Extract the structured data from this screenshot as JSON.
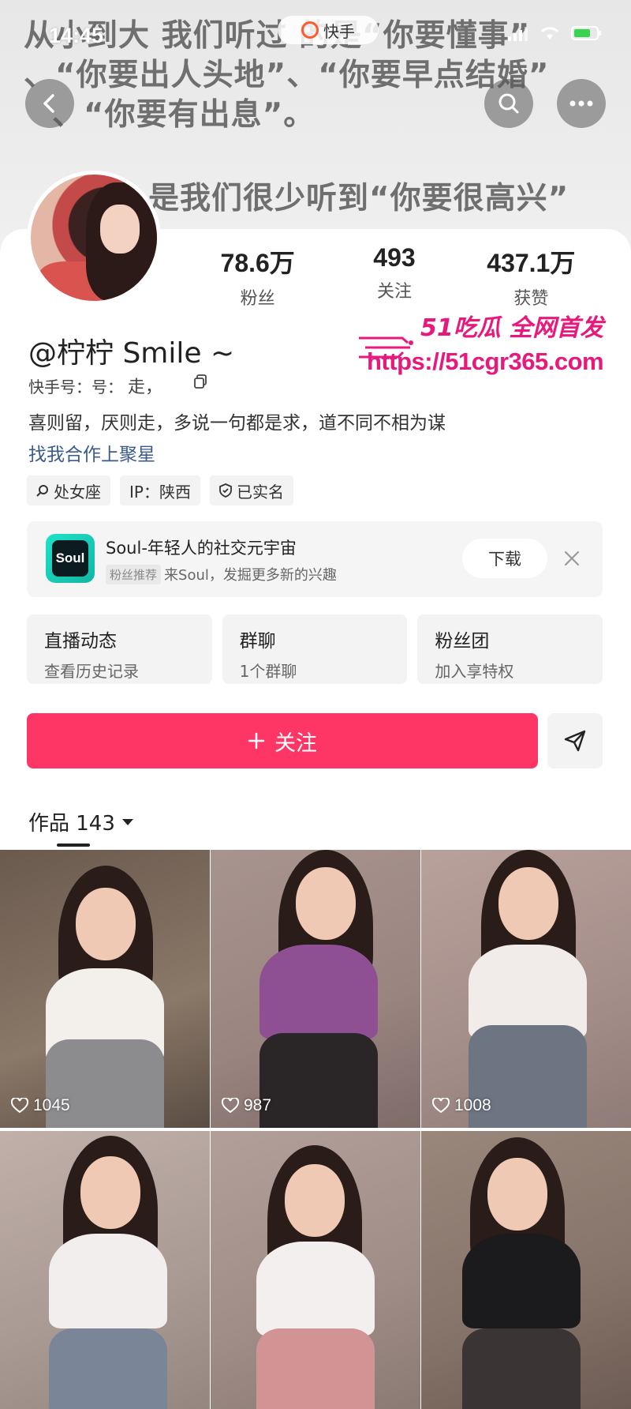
{
  "status_bar": {
    "time": "14:45"
  },
  "banner": {
    "lines": [
      "从小到大 我们听过        的是“你要懂事”",
      "、“你要出人头地”、“你要早点结婚”",
      "、“你要有出息”。",
      "是我们很少听到“你要很高兴”"
    ],
    "app_pill": "快手"
  },
  "profile": {
    "stats": [
      {
        "value": "78.6万",
        "label": "粉丝"
      },
      {
        "value": "493",
        "label": "关注"
      },
      {
        "value": "437.1万",
        "label": "获赞"
      }
    ],
    "name": "@柠柠 Smile ~",
    "kuaishou_id_label": "快手号：号：",
    "kuaishou_id_value": "走，",
    "bio": "喜则留，厌则走，多说一句都是求，道不同不相为谋",
    "link": "找我合作上聚星",
    "tags": [
      {
        "icon": "search-icon",
        "text": "处女座"
      },
      {
        "icon": "",
        "text": "IP：陕西"
      },
      {
        "icon": "shield-icon",
        "text": "已实名"
      }
    ]
  },
  "watermark": {
    "line1": "51吃瓜 全网首发",
    "line2": "https://51cgr365.com"
  },
  "ad": {
    "logo_text": "Soul",
    "title": "Soul-年轻人的社交元宇宙",
    "badge": "粉丝推荐",
    "subtitle": "来Soul，发掘更多新的兴趣",
    "button": "下载"
  },
  "entries": [
    {
      "title": "直播动态",
      "sub": "查看历史记录"
    },
    {
      "title": "群聊",
      "sub": "1个群聊"
    },
    {
      "title": "粉丝团",
      "sub": "加入享特权"
    }
  ],
  "actions": {
    "follow_label": "关注"
  },
  "works": {
    "label": "作品 143"
  },
  "videos": [
    {
      "likes": "1045",
      "bg": "#7a6a5c",
      "top": "#f3efea",
      "bottom": "#8c8c8e"
    },
    {
      "likes": "987",
      "bg": "#9e8a86",
      "top": "#8e4f93",
      "bottom": "#2a2526"
    },
    {
      "likes": "1008",
      "bg": "#a8928d",
      "top": "#f1ecea",
      "bottom": "#6d7482"
    },
    {
      "likes": "",
      "bg": "#b3a39c",
      "top": "#f2eeee",
      "bottom": "#7b8598"
    },
    {
      "likes": "",
      "bg": "#a7938d",
      "top": "#f4efef",
      "bottom": "#d19394"
    },
    {
      "likes": "",
      "bg": "#8d7a70",
      "top": "#1b1b1d",
      "bottom": "#3b3434"
    }
  ],
  "colors": {
    "follow_button": "#fe3666",
    "link": "#3a5a8c",
    "watermark": "#e8197c"
  }
}
